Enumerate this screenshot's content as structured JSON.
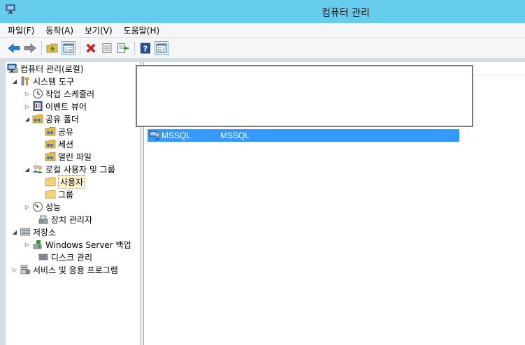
{
  "window": {
    "title": "컴퓨터 관리"
  },
  "menu": [
    "파일(F)",
    "동작(A)",
    "보기(V)",
    "도움말(H)"
  ],
  "toolbar": {
    "icons": [
      "back-arrow-icon",
      "forward-arrow-icon",
      "up-folder-icon",
      "show-hide-tree-icon",
      "delete-icon",
      "properties-icon",
      "export-list-icon",
      "help-icon",
      "action-pane-icon"
    ]
  },
  "tree": [
    {
      "label": "컴퓨터 관리(로컬)",
      "icon": "computer-management-icon"
    },
    {
      "label": "시스템 도구",
      "icon": "system-tools-icon",
      "expanded": true
    },
    {
      "label": "작업 스케줄러",
      "icon": "task-scheduler-icon"
    },
    {
      "label": "이벤트 뷰어",
      "icon": "event-viewer-icon"
    },
    {
      "label": "공유 폴더",
      "icon": "shared-folder-icon",
      "expanded": true
    },
    {
      "label": "공유",
      "icon": "share-icon"
    },
    {
      "label": "세션",
      "icon": "session-icon"
    },
    {
      "label": "열린 파일",
      "icon": "open-files-icon"
    },
    {
      "label": "로컬 사용자 및 그룹",
      "icon": "local-users-groups-icon",
      "expanded": true
    },
    {
      "label": "사용자",
      "icon": "folder-icon",
      "selected": true
    },
    {
      "label": "그룹",
      "icon": "folder-icon"
    },
    {
      "label": "성능",
      "icon": "performance-icon"
    },
    {
      "label": "장치 관리자",
      "icon": "device-manager-icon"
    },
    {
      "label": "저장소",
      "icon": "storage-icon",
      "expanded": true
    },
    {
      "label": "Windows Server 백업",
      "icon": "windows-backup-icon"
    },
    {
      "label": "디스크 관리",
      "icon": "disk-management-icon"
    },
    {
      "label": "서비스 및 응용 프로그램",
      "icon": "services-apps-icon"
    }
  ],
  "list": {
    "rows": [
      {
        "name": "MSSQL",
        "full_name": "MSSQL",
        "selected": true
      }
    ]
  },
  "colors": {
    "titlebar": "#66cdee",
    "selection": "#3399ff",
    "tree_selection": "#fff3cc"
  }
}
